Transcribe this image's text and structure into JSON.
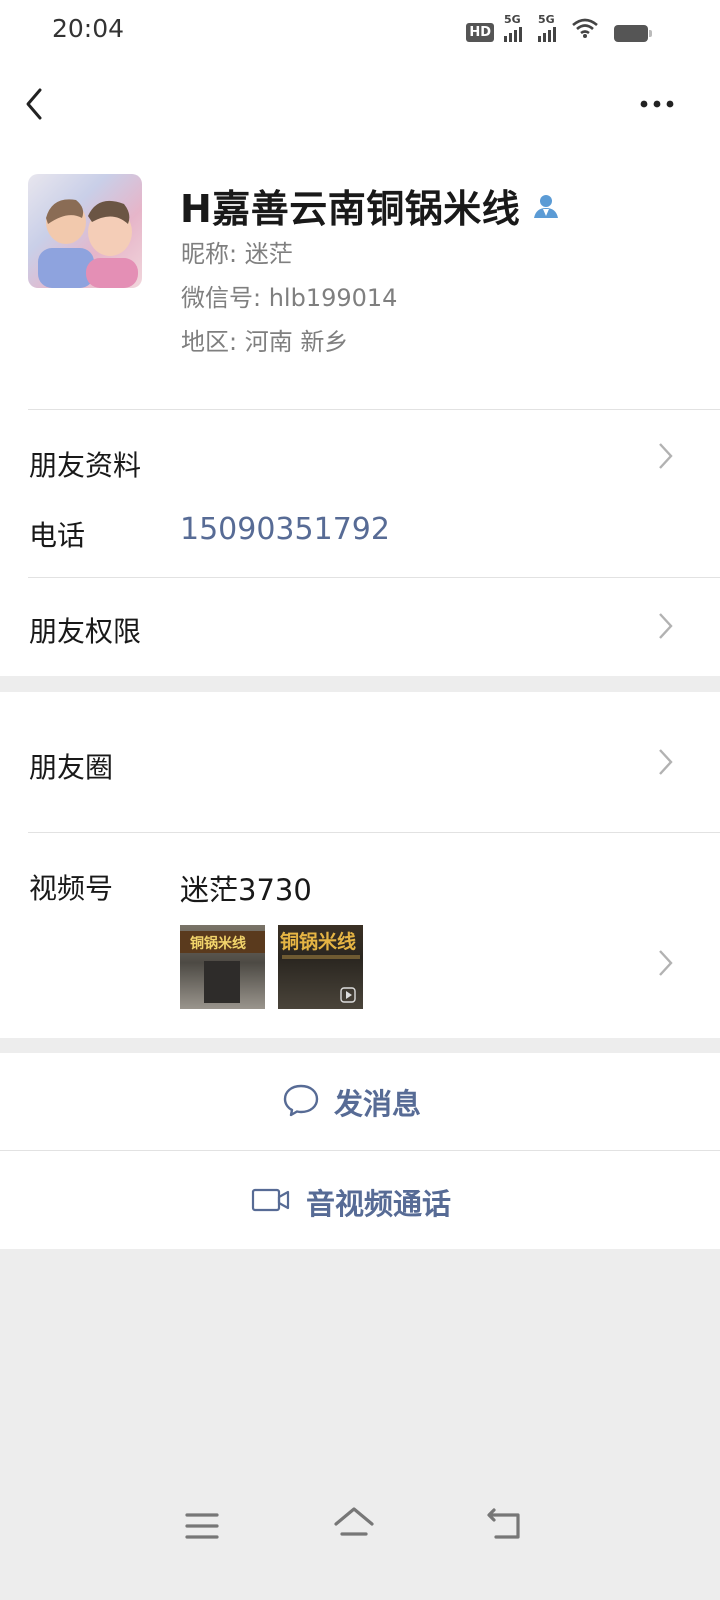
{
  "status_bar": {
    "time": "20:04",
    "icons": [
      "hd-icon",
      "5g-signal-icon",
      "5g-signal-icon",
      "wifi-icon",
      "battery-icon"
    ],
    "hd_label": "HD",
    "network_label": "5G"
  },
  "nav": {
    "back_icon": "back-chevron-icon",
    "more_icon": "more-dots-icon"
  },
  "profile": {
    "name": "H嘉善云南铜锅米线",
    "nickname": "昵称: 迷茫",
    "wechat_id": "微信号: hlb199014",
    "region": "地区: 河南  新乡",
    "badge_icon": "person-badge-icon"
  },
  "info": {
    "friend_profile_label": "朋友资料",
    "phone_label": "电话",
    "phone_value": "15090351792",
    "permissions_label": "朋友权限"
  },
  "moments": {
    "label": "朋友圈"
  },
  "channels": {
    "label": "视频号",
    "name": "迷茫3730",
    "thumb1_text": "铜锅米线",
    "thumb2_text": "铜锅米线"
  },
  "actions": {
    "message_label": "发消息",
    "call_label": "音视频通话"
  },
  "colors": {
    "accent": "#576b95",
    "background": "#ededed"
  },
  "system_nav": {
    "icons": [
      "menu-icon",
      "home-icon",
      "back-icon"
    ]
  }
}
